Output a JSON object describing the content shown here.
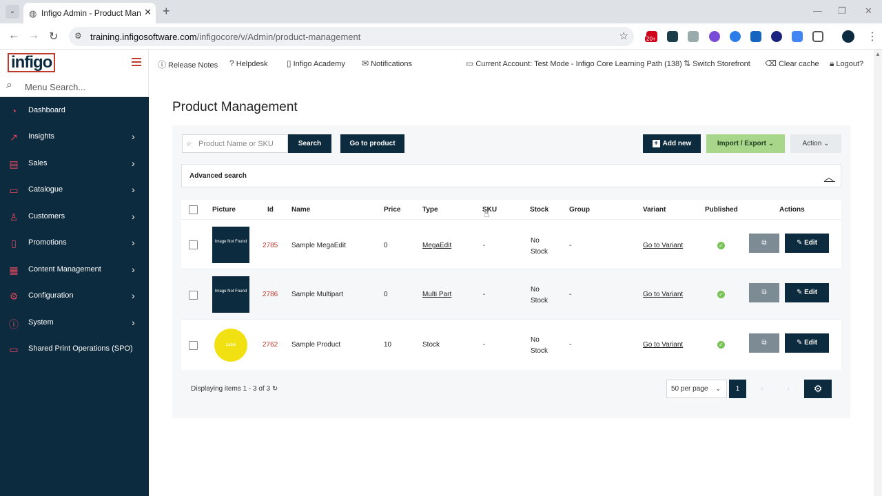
{
  "browser": {
    "tab_title": "Infigo Admin - Product Management",
    "tab_icon": "globe-icon",
    "url_domain": "training.infigosoftware.com",
    "url_path": "/infigocore/v/Admin/product-management",
    "ext_badge": "20+"
  },
  "sidebar": {
    "logo": "infigo",
    "search_placeholder": "Menu Search...",
    "items": [
      {
        "label": "Dashboard",
        "icon": "dashboard-icon"
      },
      {
        "label": "Insights",
        "icon": "chart-line-icon"
      },
      {
        "label": "Sales",
        "icon": "cart-icon"
      },
      {
        "label": "Catalogue",
        "icon": "folder-icon"
      },
      {
        "label": "Customers",
        "icon": "user-icon"
      },
      {
        "label": "Promotions",
        "icon": "bookmark-icon"
      },
      {
        "label": "Content Management",
        "icon": "layout-icon"
      },
      {
        "label": "Configuration",
        "icon": "gear-icon"
      },
      {
        "label": "System",
        "icon": "info-icon"
      },
      {
        "label": "Shared Print Operations (SPO)",
        "icon": "printer-icon"
      }
    ]
  },
  "topnav": {
    "release_notes": "Release Notes",
    "helpdesk": "Helpdesk",
    "academy": "Infigo Academy",
    "notifications": "Notifications",
    "account": "Current Account: Test Mode - Infigo Core Learning Path (138)",
    "switch_storefront": "Switch Storefront",
    "clear_cache": "Clear cache",
    "logout": "Logout?"
  },
  "page": {
    "title": "Product Management",
    "search_placeholder": "Product Name or SKU",
    "search_btn": "Search",
    "goto_btn": "Go to product",
    "add_new": "Add new",
    "import_export": "Import / Export",
    "action": "Action",
    "advanced_search": "Advanced search"
  },
  "table": {
    "headers": {
      "picture": "Picture",
      "id": "Id",
      "name": "Name",
      "price": "Price",
      "type": "Type",
      "sku": "SKU",
      "stock": "Stock",
      "group": "Group",
      "variant": "Variant",
      "published": "Published",
      "actions": "Actions"
    },
    "rows": [
      {
        "picture": "Image Not Found",
        "id": "2785",
        "name": "Sample MegaEdit",
        "price": "0",
        "type": "MegaEdit",
        "sku": "-",
        "stock": "No Stock",
        "group": "-",
        "variant": "Go to Variant",
        "edit": "Edit"
      },
      {
        "picture": "Image Not Found",
        "id": "2786",
        "name": "Sample Multipart",
        "price": "0",
        "type": "Multi Part",
        "sku": "-",
        "stock": "No Stock",
        "group": "-",
        "variant": "Go to Variant",
        "edit": "Edit"
      },
      {
        "picture": "Label",
        "id": "2762",
        "name": "Sample Product",
        "price": "10",
        "type": "Stock",
        "sku": "-",
        "stock": "No Stock",
        "group": "-",
        "variant": "Go to Variant",
        "edit": "Edit"
      }
    ]
  },
  "footer": {
    "displaying": "Displaying items 1 - 3 of 3",
    "per_page": "50 per page",
    "current_page": "1"
  },
  "colors": {
    "sidebar_bg": "#0d2b3e",
    "accent_red": "#c0392b",
    "import_green": "#a8d68a"
  }
}
